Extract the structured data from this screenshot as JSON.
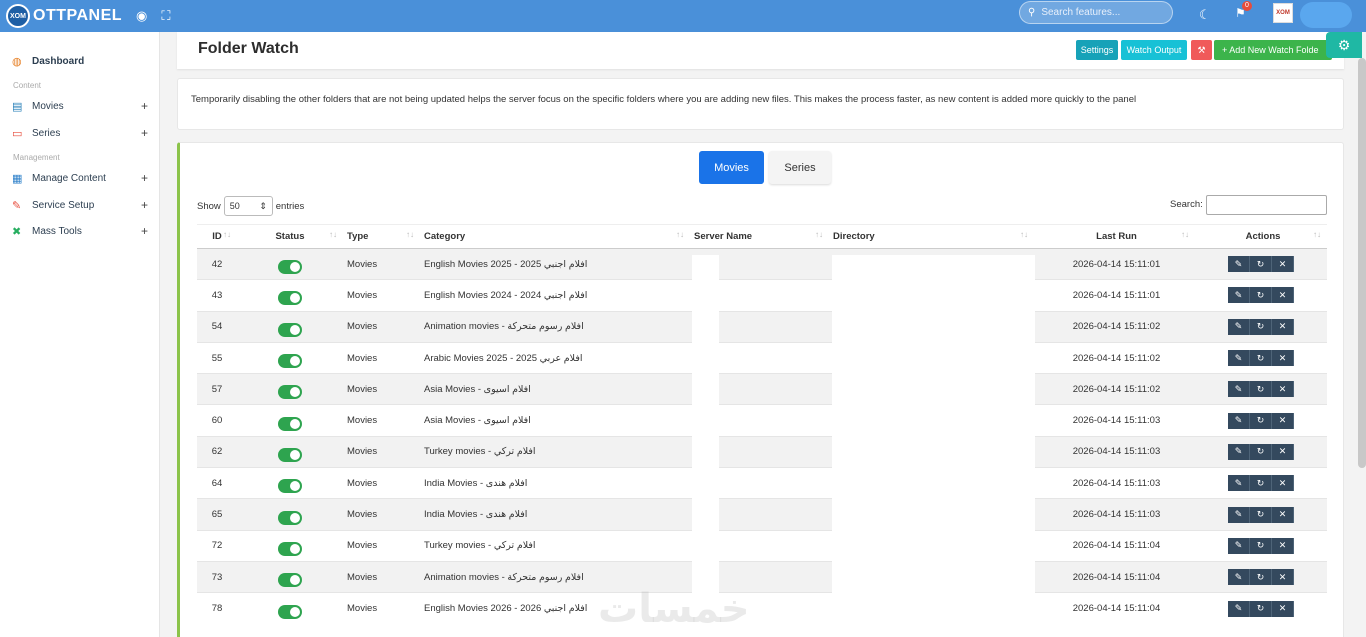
{
  "topbar": {
    "logo_badge": "XOM",
    "logo_text": "OTTPANEL",
    "search_placeholder": "Search features...",
    "notification_count": "0",
    "avatar_text": "XOM"
  },
  "sidebar": {
    "dashboard": "Dashboard",
    "section_content": "Content",
    "movies": "Movies",
    "series": "Series",
    "section_management": "Management",
    "manage_content": "Manage Content",
    "service_setup": "Service Setup",
    "mass_tools": "Mass Tools"
  },
  "header": {
    "title": "Folder Watch",
    "settings": "Settings",
    "watch_output": "Watch Output",
    "add_new": "+ Add New Watch Folde"
  },
  "info": {
    "text": "Temporarily disabling the other folders that are not being updated helps the server focus on the specific folders where you are adding new files. This makes the process faster, as new content is added more quickly to the panel"
  },
  "tabs": {
    "movies": "Movies",
    "series": "Series"
  },
  "table_controls": {
    "show": "Show",
    "entries_value": "50",
    "entries": "entries",
    "search": "Search:"
  },
  "columns": {
    "id": "ID",
    "status": "Status",
    "type": "Type",
    "category": "Category",
    "server_name": "Server Name",
    "directory": "Directory",
    "last_run": "Last Run",
    "actions": "Actions"
  },
  "rows": [
    {
      "id": "42",
      "type": "Movies",
      "category": "English Movies 2025 - 2025 افلام اجنبي",
      "last_run": "2026-04-14 15:11:01"
    },
    {
      "id": "43",
      "type": "Movies",
      "category": "English Movies 2024 - 2024 افلام اجنبي",
      "last_run": "2026-04-14 15:11:01"
    },
    {
      "id": "54",
      "type": "Movies",
      "category": "Animation movies - افلام رسوم متحركة",
      "last_run": "2026-04-14 15:11:02"
    },
    {
      "id": "55",
      "type": "Movies",
      "category": "Arabic Movies 2025 - 2025 افلام عربي",
      "last_run": "2026-04-14 15:11:02"
    },
    {
      "id": "57",
      "type": "Movies",
      "category": "Asia Movies - افلام اسيوى",
      "last_run": "2026-04-14 15:11:02"
    },
    {
      "id": "60",
      "type": "Movies",
      "category": "Asia Movies - افلام اسيوى",
      "last_run": "2026-04-14 15:11:03"
    },
    {
      "id": "62",
      "type": "Movies",
      "category": "Turkey movies - افلام تركي",
      "last_run": "2026-04-14 15:11:03"
    },
    {
      "id": "64",
      "type": "Movies",
      "category": "India Movies - افلام هندى",
      "last_run": "2026-04-14 15:11:03"
    },
    {
      "id": "65",
      "type": "Movies",
      "category": "India Movies - افلام هندى",
      "last_run": "2026-04-14 15:11:03"
    },
    {
      "id": "72",
      "type": "Movies",
      "category": "Turkey movies - افلام تركي",
      "last_run": "2026-04-14 15:11:04"
    },
    {
      "id": "73",
      "type": "Movies",
      "category": "Animation movies - افلام رسوم متحركة",
      "last_run": "2026-04-14 15:11:04"
    },
    {
      "id": "78",
      "type": "Movies",
      "category": "English Movies 2026 - 2026 افلام اجنبي",
      "last_run": "2026-04-14 15:11:04"
    }
  ],
  "watermark": "خمسات",
  "colors": {
    "topbar": "#4a90d9",
    "teal_button": "#17a2b8",
    "red_button": "#f05a5a",
    "green_button": "#3cb44b",
    "tab_active": "#1a73e8",
    "toggle_on": "#2ea44f",
    "action_button": "#34495e",
    "card_accent": "#8bc34a"
  }
}
